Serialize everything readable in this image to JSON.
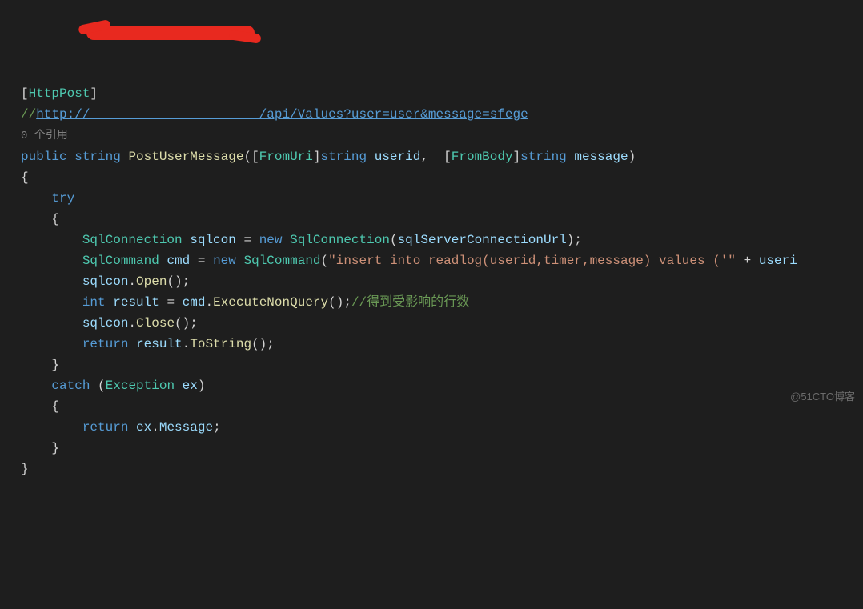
{
  "code": {
    "attribute": "HttpPost",
    "commentPrefix": "//",
    "urlPart1": "http://",
    "urlRedactedSpace": "                      ",
    "urlPart2": "/api/Values?user=user&message=sfege",
    "references": "0 个引用",
    "sig": {
      "public": "public",
      "string": "string",
      "method": "PostUserMessage",
      "fromUri": "FromUri",
      "p1type": "string",
      "p1": "userid",
      "fromBody": "FromBody",
      "p2type": "string",
      "p2": "message"
    },
    "try": "try",
    "l1": {
      "type": "SqlConnection",
      "var": "sqlcon",
      "new": "new",
      "ctor": "SqlConnection",
      "arg": "sqlServerConnectionUrl"
    },
    "l2": {
      "type": "SqlCommand",
      "var": "cmd",
      "new": "new",
      "ctor": "SqlCommand",
      "str": "\"insert into readlog(userid,timer,message) values ('\"",
      "plus": " + ",
      "tail": "useri"
    },
    "l3": {
      "obj": "sqlcon",
      "call": "Open"
    },
    "l4": {
      "kw": "int",
      "var": "result",
      "obj": "cmd",
      "call": "ExecuteNonQuery",
      "comment": "//得到受影响的行数"
    },
    "l5": {
      "obj": "sqlcon",
      "call": "Close"
    },
    "l6": {
      "kw": "return",
      "obj": "result",
      "call": "ToString"
    },
    "catch": {
      "kw": "catch",
      "type": "Exception",
      "var": "ex"
    },
    "l7": {
      "kw": "return",
      "obj": "ex",
      "prop": "Message"
    }
  },
  "watermark": "@51CTO博客"
}
